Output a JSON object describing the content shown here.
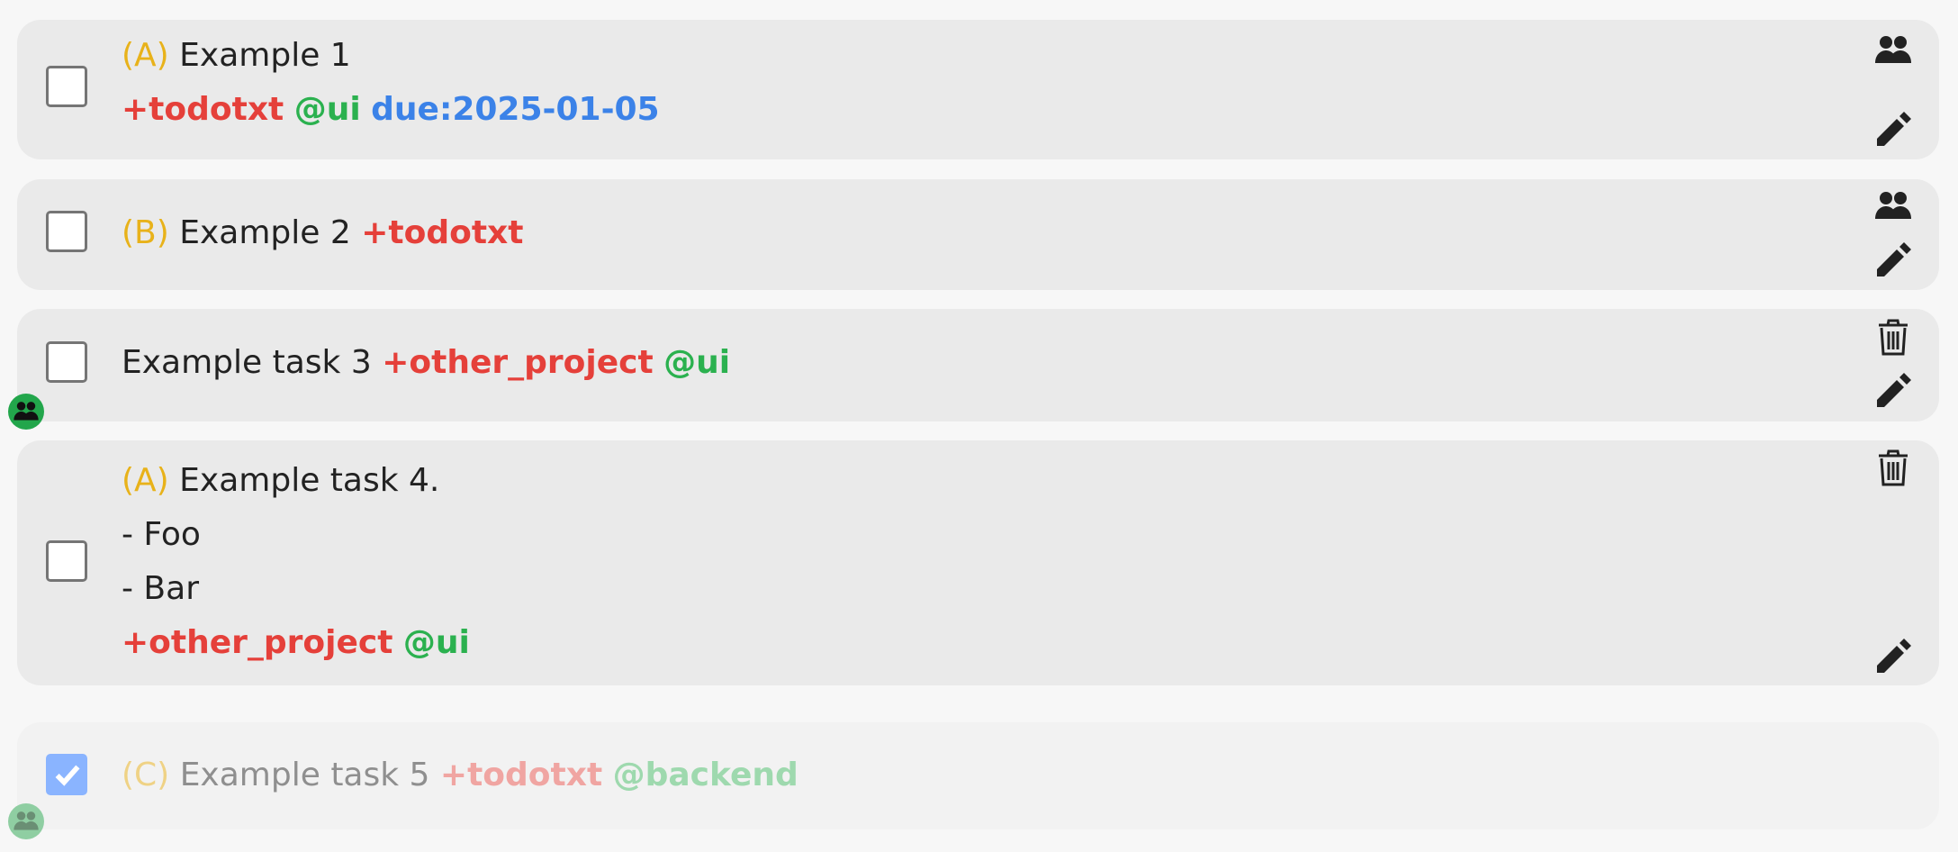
{
  "colors": {
    "priority": "#e8b21a",
    "project": "#e5403a",
    "context": "#2bb14f",
    "due": "#3b82e8",
    "card": "#eaeaea",
    "checked": "#8ab4ff",
    "badge": "#22a64b"
  },
  "tasks": [
    {
      "checked": false,
      "line1": {
        "priority": "(A)",
        "title": "Example 1"
      },
      "line2": {
        "project": "+todotxt",
        "context": "@ui",
        "due": "due:2025-01-05"
      },
      "icons": [
        "group-icon",
        "edit-icon"
      ]
    },
    {
      "checked": false,
      "line1": {
        "priority": "(B)",
        "title": "Example 2",
        "project": "+todotxt"
      },
      "icons": [
        "group-icon",
        "edit-icon"
      ]
    },
    {
      "checked": false,
      "line1": {
        "title": "Example task 3",
        "project": "+other_project",
        "context": "@ui"
      },
      "icons": [
        "trash-icon",
        "edit-icon"
      ],
      "shared_badge": "group-icon"
    },
    {
      "checked": false,
      "line1": {
        "priority": "(A)",
        "title": "Example task 4."
      },
      "line2": "- Foo",
      "line3": "- Bar",
      "line4": {
        "project": "+other_project",
        "context": "@ui"
      },
      "icons": [
        "trash-icon",
        "edit-icon"
      ]
    },
    {
      "checked": true,
      "line1": {
        "priority": "(C)",
        "title": "Example task 5",
        "project": "+todotxt",
        "context": "@backend"
      },
      "shared_badge": "group-icon"
    }
  ]
}
